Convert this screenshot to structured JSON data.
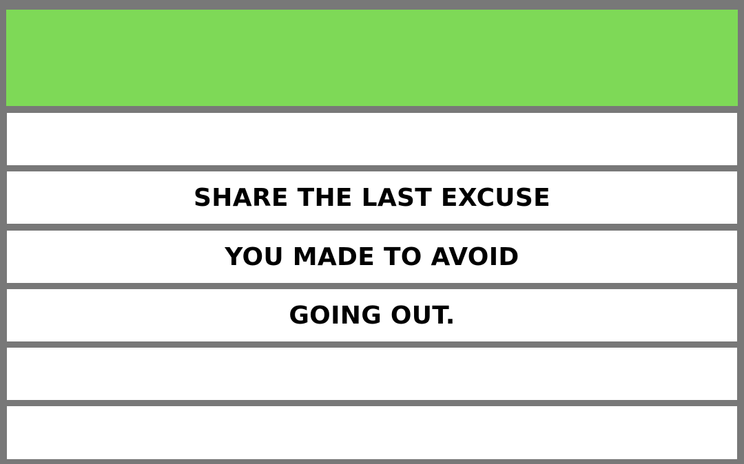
{
  "card": {
    "lines": [
      "",
      "SHARE THE LAST EXCUSE",
      "YOU MADE TO AVOID",
      "GOING OUT.",
      "",
      ""
    ]
  },
  "colors": {
    "header": "#7ed957",
    "frame": "#787878",
    "row": "#ffffff",
    "text": "#000000"
  }
}
